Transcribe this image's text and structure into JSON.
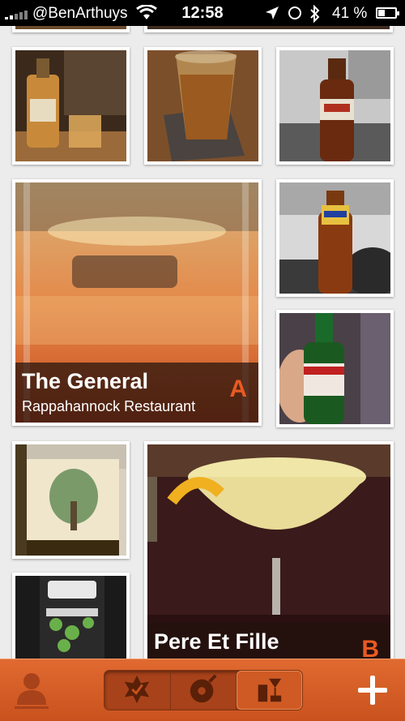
{
  "status_bar": {
    "carrier": "@BenArthuys",
    "time": "12:58",
    "battery": "41 %",
    "battery_level": 0.41
  },
  "feed": {
    "featured": [
      {
        "name": "The General",
        "place": "Rappahannock Restaurant",
        "letter": "A"
      },
      {
        "name": "Pere Et Fille",
        "place": "",
        "letter": "B"
      }
    ],
    "photos": [
      {
        "icon": "whiskey-bottle-photo"
      },
      {
        "icon": "beer-glass-photo"
      },
      {
        "icon": "beer-bottle-photo"
      },
      {
        "icon": "cocktail-glass-photo"
      },
      {
        "icon": "beer-bottle-photo"
      },
      {
        "icon": "stella-artois-bottle-photo"
      },
      {
        "icon": "anchor-brewing-bottle-photo"
      },
      {
        "icon": "coupe-cocktail-photo"
      },
      {
        "icon": "ruckus-beer-can-photo"
      }
    ]
  },
  "tab_bar": {
    "active_tab": "drinks",
    "accent_color": "#d75b25",
    "items": [
      {
        "name": "profile-tab",
        "icon": "person-icon"
      },
      {
        "name": "favorites-tab",
        "icon": "badge-icon"
      },
      {
        "name": "explore-tab",
        "icon": "compass-icon"
      },
      {
        "name": "drinks-tab",
        "icon": "drinks-icon"
      },
      {
        "name": "add-button",
        "icon": "plus-icon"
      }
    ]
  }
}
